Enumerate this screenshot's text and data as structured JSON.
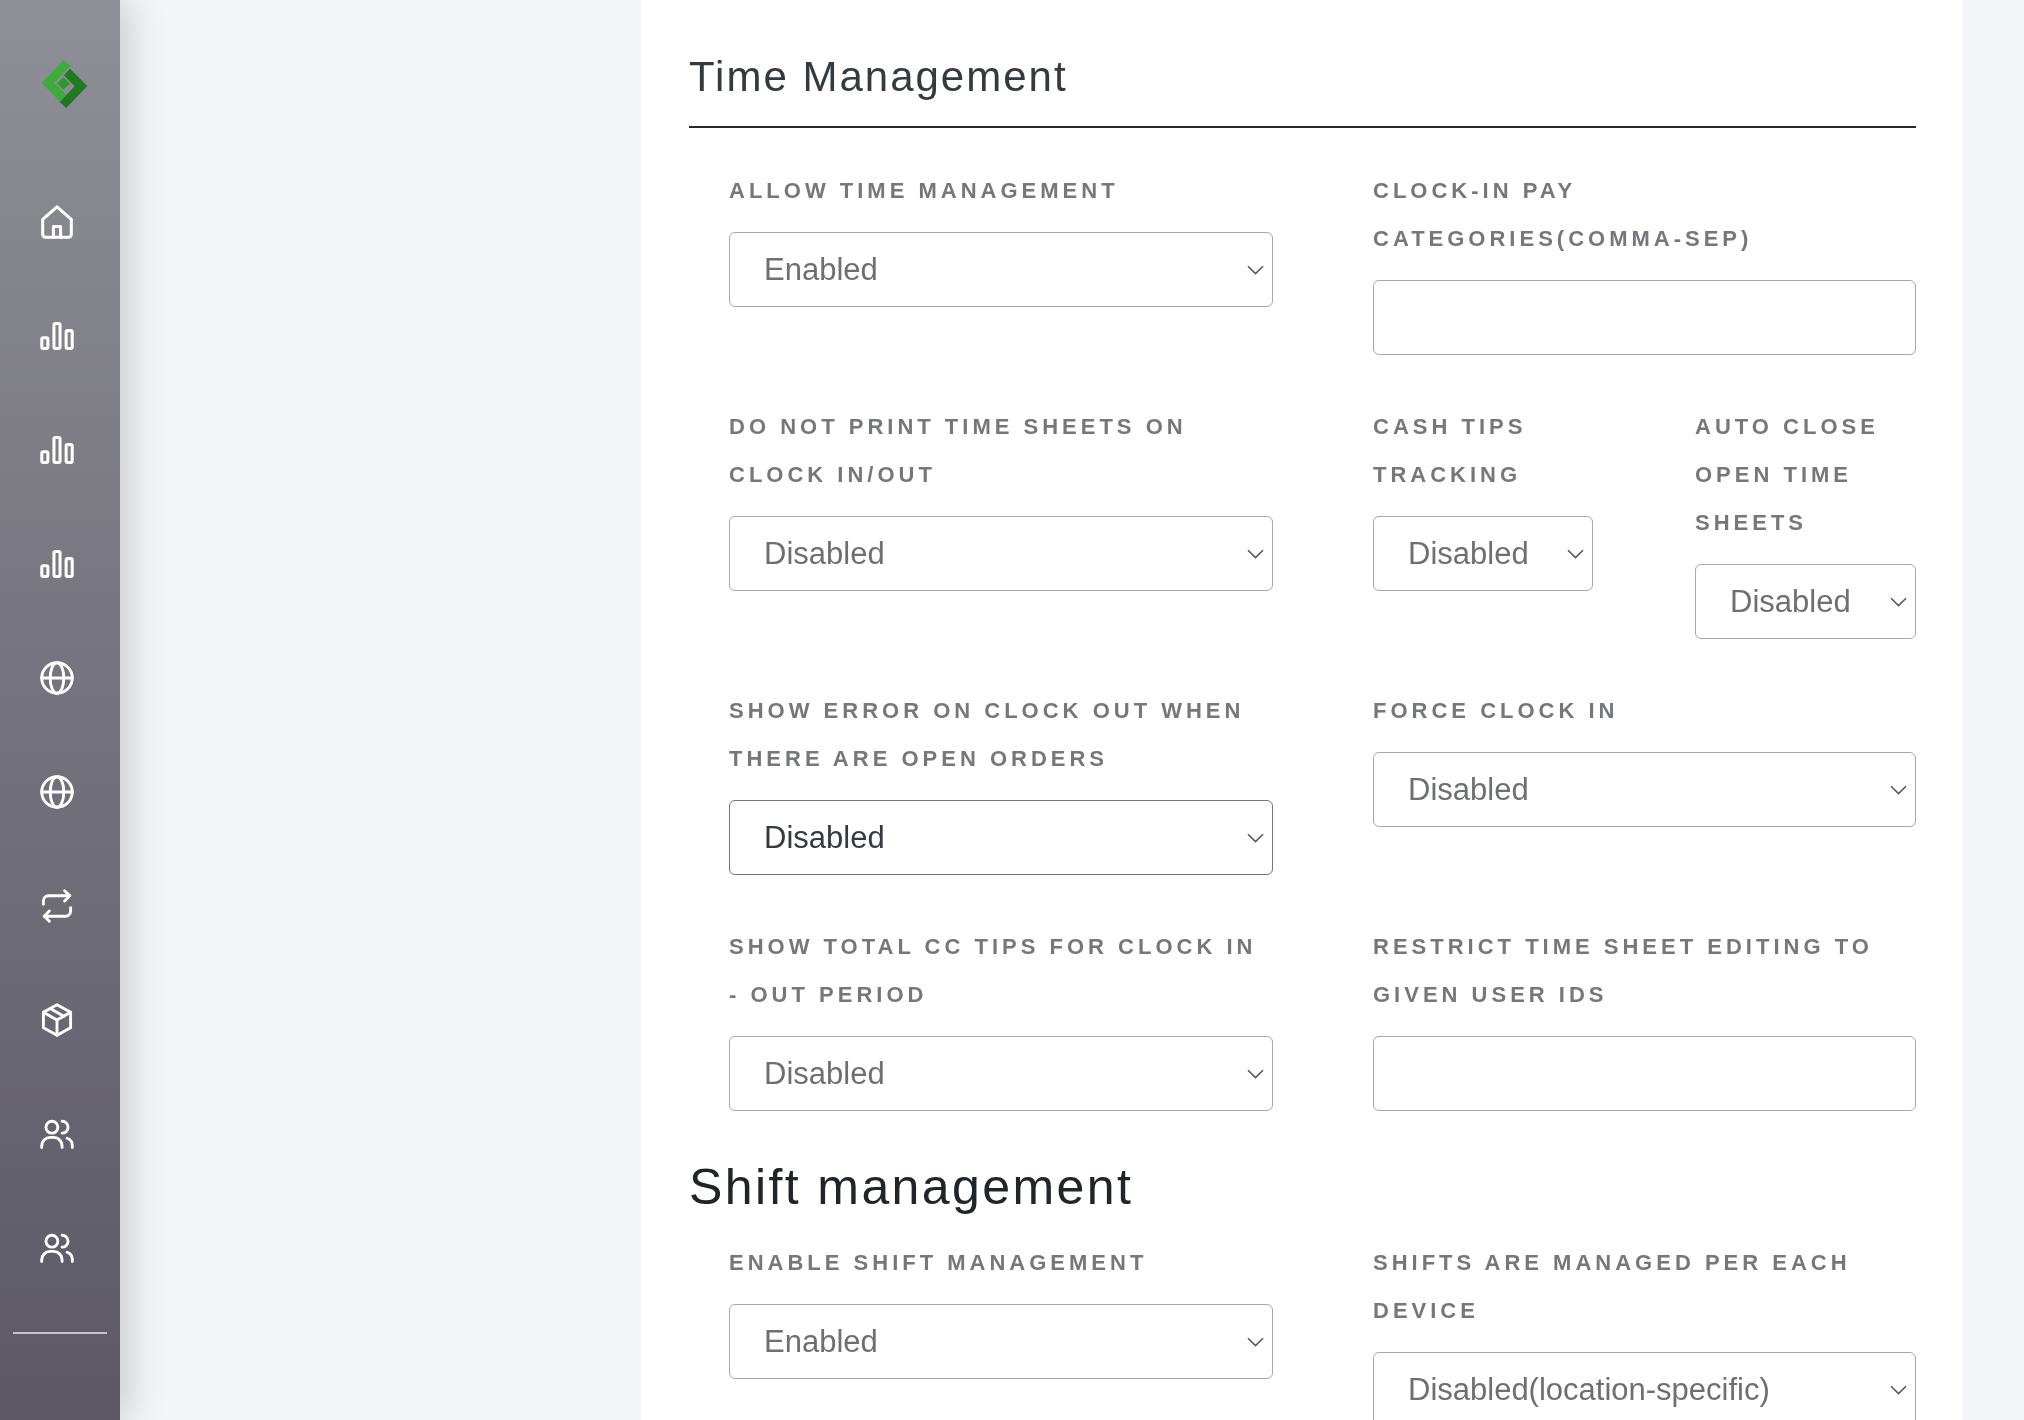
{
  "sections": [
    {
      "title": "Time Management",
      "kind": "ruled",
      "rows": [
        {
          "columns": [
            {
              "fields": [
                {
                  "label": "ALLOW TIME MANAGEMENT",
                  "kind": "select",
                  "value": "Enabled",
                  "focused": false
                }
              ]
            },
            {
              "fields": [
                {
                  "label": "CLOCK-IN PAY CATEGORIES(COMMA-SEP)",
                  "kind": "text",
                  "focused": false
                }
              ]
            }
          ]
        },
        {
          "columns": [
            {
              "fields": [
                {
                  "label": "DO NOT PRINT TIME SHEETS ON CLOCK IN/OUT",
                  "kind": "select",
                  "value": "Disabled",
                  "focused": false
                }
              ]
            },
            {
              "fields": [
                {
                  "label": "CASH TIPS TRACKING",
                  "kind": "select",
                  "value": "Disabled",
                  "focused": false
                },
                {
                  "label": "AUTO CLOSE OPEN TIME SHEETS",
                  "kind": "select",
                  "value": "Disabled",
                  "focused": false
                }
              ]
            }
          ]
        },
        {
          "columns": [
            {
              "fields": [
                {
                  "label": "SHOW ERROR ON CLOCK OUT WHEN THERE ARE OPEN ORDERS",
                  "kind": "select",
                  "value": "Disabled",
                  "focused": true
                }
              ]
            },
            {
              "fields": [
                {
                  "label": "FORCE CLOCK IN",
                  "kind": "select",
                  "value": "Disabled",
                  "focused": false
                }
              ]
            }
          ]
        },
        {
          "columns": [
            {
              "fields": [
                {
                  "label": "SHOW TOTAL CC TIPS FOR CLOCK IN - OUT PERIOD",
                  "kind": "select",
                  "value": "Disabled",
                  "focused": false
                }
              ]
            },
            {
              "fields": [
                {
                  "label": "RESTRICT TIME SHEET EDITING TO GIVEN USER IDS",
                  "kind": "text",
                  "focused": false
                }
              ]
            }
          ]
        }
      ]
    },
    {
      "title": "Shift management",
      "kind": "plain",
      "rows": [
        {
          "columns": [
            {
              "fields": [
                {
                  "label": "ENABLE SHIFT MANAGEMENT",
                  "kind": "select",
                  "value": "Enabled",
                  "focused": false
                }
              ]
            },
            {
              "fields": [
                {
                  "label": "SHIFTS ARE MANAGED PER EACH DEVICE",
                  "kind": "select",
                  "value": "Disabled(location-specific)",
                  "focused": false
                }
              ]
            }
          ]
        }
      ]
    }
  ]
}
